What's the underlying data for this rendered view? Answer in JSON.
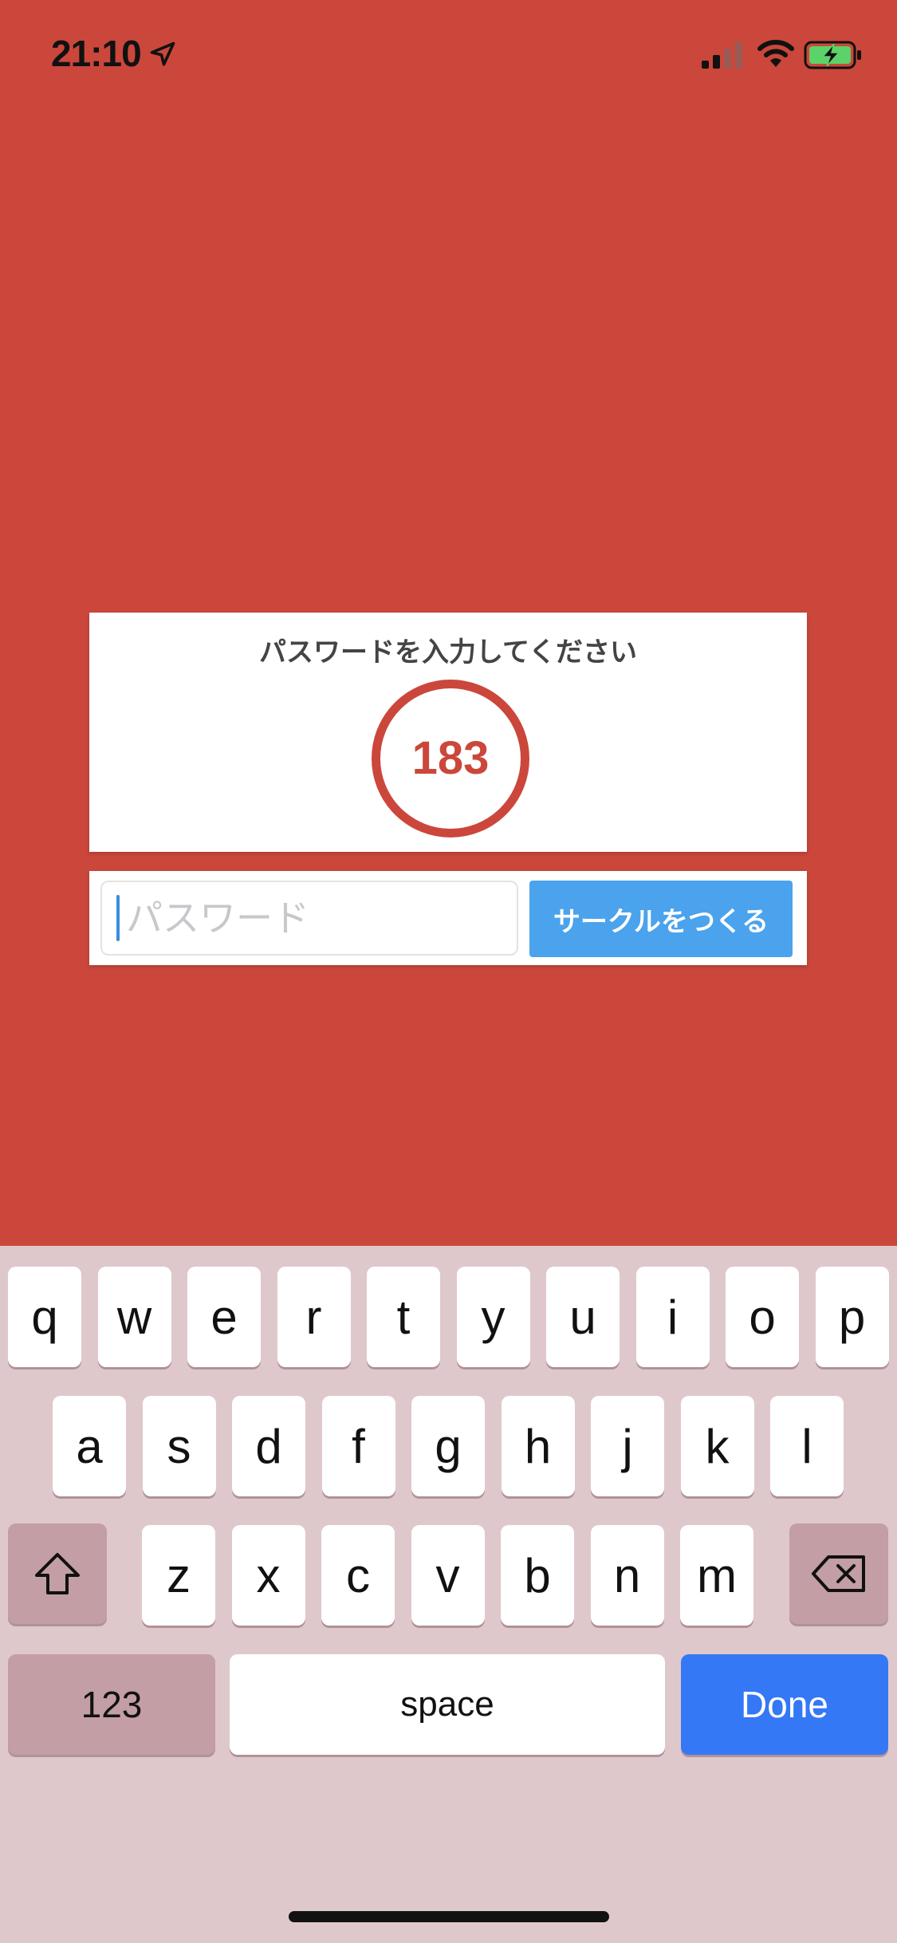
{
  "status_bar": {
    "time": "21:10",
    "icons": [
      "location-arrow-icon",
      "signal-icon",
      "wifi-icon",
      "battery-charging-icon"
    ]
  },
  "card": {
    "title": "パスワードを入力してください",
    "count": "183"
  },
  "password_input": {
    "value": "",
    "placeholder": "パスワード"
  },
  "make_circle_button": {
    "label": "サークルをつくる"
  },
  "keyboard": {
    "row1": [
      "q",
      "w",
      "e",
      "r",
      "t",
      "y",
      "u",
      "i",
      "o",
      "p"
    ],
    "row2": [
      "a",
      "s",
      "d",
      "f",
      "g",
      "h",
      "j",
      "k",
      "l"
    ],
    "row3": [
      "z",
      "x",
      "c",
      "v",
      "b",
      "n",
      "m"
    ],
    "shift_icon": "shift-icon",
    "delete_icon": "delete-icon",
    "numbers_label": "123",
    "space_label": "space",
    "done_label": "Done"
  },
  "colors": {
    "background": "#CB473B",
    "button": "#4AA3EC",
    "done": "#3478F6",
    "keyboard": "#DFC8CC"
  }
}
